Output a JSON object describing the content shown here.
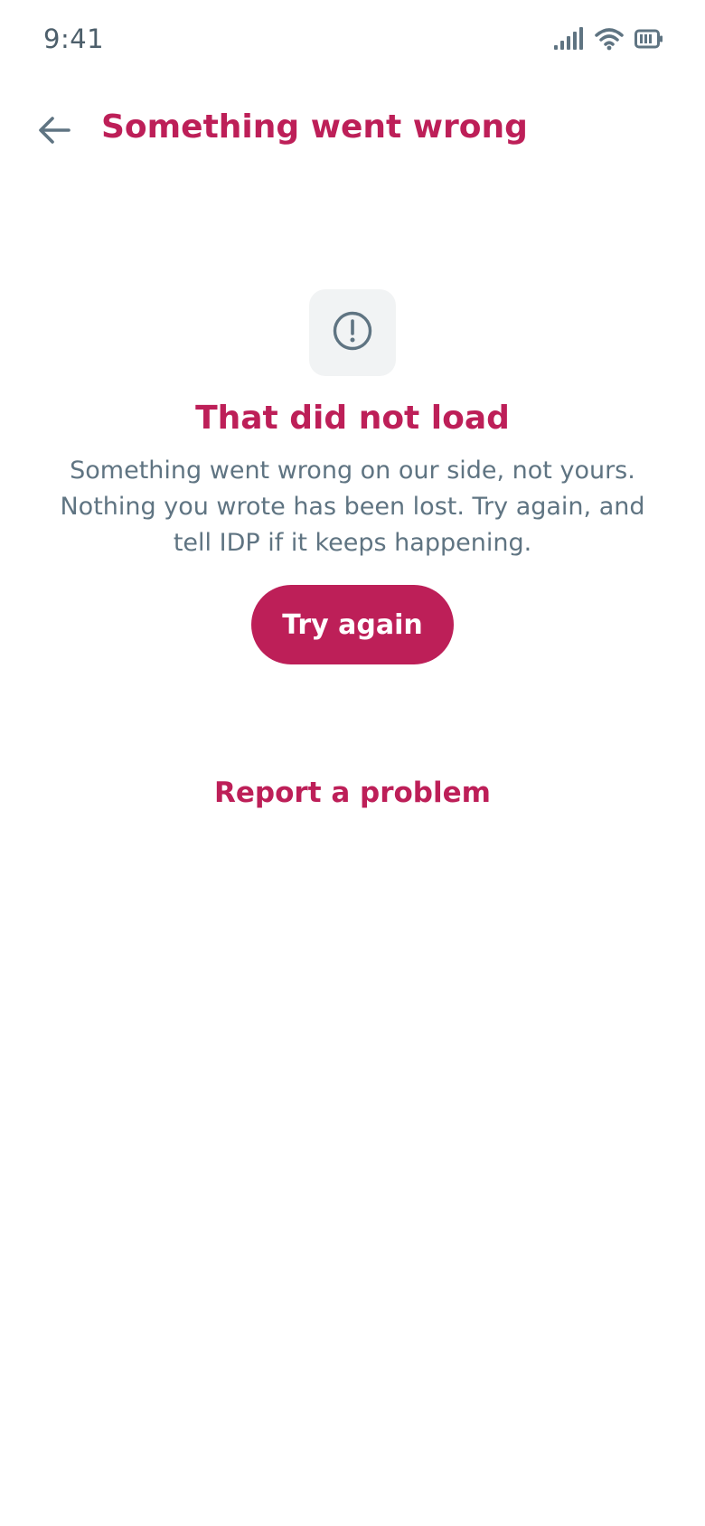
{
  "status_bar": {
    "time": "9:41",
    "icons": [
      "signal-icon",
      "wifi-icon",
      "battery-icon"
    ]
  },
  "app_bar": {
    "back_icon": "arrow-left-icon",
    "title": "Something went wrong"
  },
  "error": {
    "icon": "alert-circle-icon",
    "heading": "That did not load",
    "body": "Something went wrong on our side, not yours. Nothing you wrote has been lost. Try again, and tell IDP if it keeps happening.",
    "retry_label": "Try again",
    "report_label": "Report a problem"
  },
  "colors": {
    "accent": "#bd1f58",
    "text_secondary": "#5f7482",
    "icon_tile_bg": "#f1f3f4",
    "background": "#ffffff"
  }
}
